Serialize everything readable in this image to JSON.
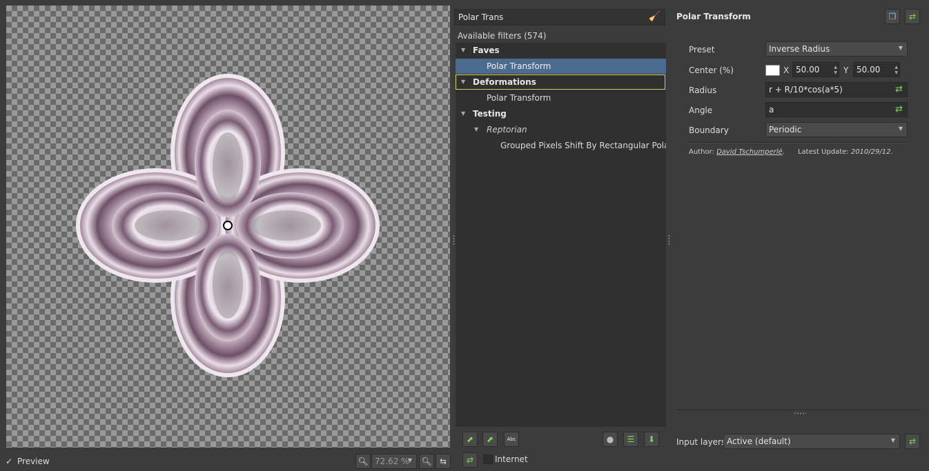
{
  "preview": {
    "preview_label": "Preview",
    "preview_checked": true,
    "check_glyph": "✓",
    "zoom_value": "72.62 %"
  },
  "filters": {
    "search_value": "Polar Trans",
    "available_label": "Available filters (574)",
    "tree": [
      {
        "label": "Faves",
        "kind": "folder",
        "level": 0
      },
      {
        "label": "Polar Transform",
        "kind": "filter",
        "level": 1,
        "selected": true
      },
      {
        "label": "Deformations",
        "kind": "folder",
        "level": 0,
        "outlined": true
      },
      {
        "label": "Polar Transform",
        "kind": "filter",
        "level": 1
      },
      {
        "label": "Testing",
        "kind": "folder",
        "level": 0
      },
      {
        "label": "Reptorian",
        "kind": "subfolder",
        "level": 1
      },
      {
        "label": "Grouped Pixels Shift By Rectangular Polar Transform",
        "kind": "filter",
        "level": 2
      }
    ],
    "internet_label": "Internet"
  },
  "params": {
    "title": "Polar Transform",
    "preset_label": "Preset",
    "preset_value": "Inverse Radius",
    "center_label": "Center (%)",
    "center_color": "#ffffff",
    "x_label": "X",
    "x_value": "50.00",
    "y_label": "Y",
    "y_value": "50.00",
    "radius_label": "Radius",
    "radius_value": "r + R/10*cos(a*5)",
    "angle_label": "Angle",
    "angle_value": "a",
    "boundary_label": "Boundary",
    "boundary_value": "Periodic",
    "author_prefix": "Author:",
    "author_name": "David Tschumperlé",
    "author_suffix": ".",
    "update_prefix": "Latest Update:",
    "update_value": "2010/29/12",
    "update_suffix": "."
  },
  "footer": {
    "input_layers_label": "Input layers",
    "input_layers_value": "Active (default)"
  },
  "icons": {
    "broom": "broom-icon",
    "refresh": "refresh-icon",
    "zoom_out": "zoom-out-icon",
    "zoom_in": "zoom-in-icon"
  },
  "colors": {
    "selection": "#4c6b8e",
    "highlight_outline": "#d6d95c",
    "accent_green": "#7bd957"
  }
}
